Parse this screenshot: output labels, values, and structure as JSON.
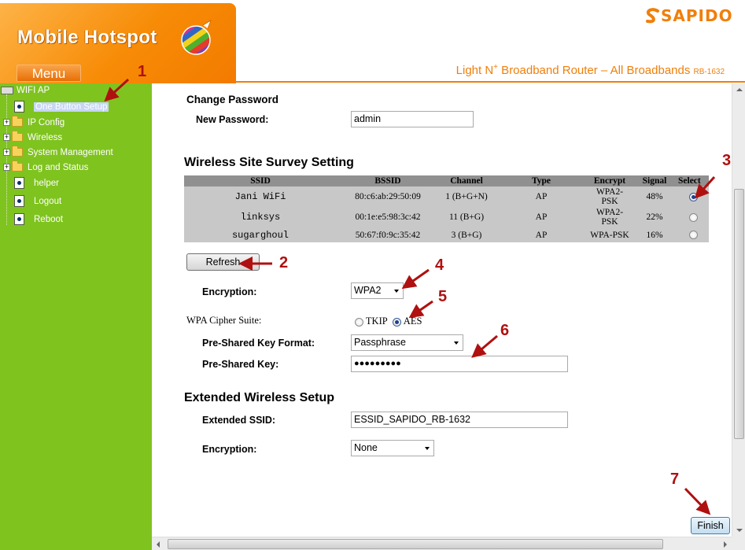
{
  "header": {
    "title": "Mobile Hotspot",
    "menu_label": "Menu",
    "logo_text": "SAPIDO",
    "tagline_prefix": "Light N",
    "tagline_sup": "+",
    "tagline_main": " Broadband Router – All Broadbands ",
    "tagline_model": "RB-1632"
  },
  "sidebar": {
    "root_label": "WIFI AP",
    "items": [
      {
        "label": "One Button Setup",
        "type": "page",
        "selected": true
      },
      {
        "label": "IP Config",
        "type": "folder"
      },
      {
        "label": "Wireless",
        "type": "folder"
      },
      {
        "label": "System Management",
        "type": "folder"
      },
      {
        "label": "Log and Status",
        "type": "folder"
      },
      {
        "label": "helper",
        "type": "page"
      },
      {
        "label": "Logout",
        "type": "page"
      },
      {
        "label": "Reboot",
        "type": "page"
      }
    ]
  },
  "change_password": {
    "title": "Change Password",
    "new_password_label": "New Password:",
    "new_password_value": "admin"
  },
  "survey": {
    "title": "Wireless Site Survey Setting",
    "columns": [
      "SSID",
      "BSSID",
      "Channel",
      "Type",
      "Encrypt",
      "Signal",
      "Select"
    ],
    "rows": [
      {
        "ssid": "Jani WiFi",
        "bssid": "80:c6:ab:29:50:09",
        "channel": "1 (B+G+N)",
        "type": "AP",
        "encrypt": "WPA2-PSK",
        "signal": "48%",
        "selected": true
      },
      {
        "ssid": "linksys",
        "bssid": "00:1e:e5:98:3c:42",
        "channel": "11 (B+G)",
        "type": "AP",
        "encrypt": "WPA2-PSK",
        "signal": "22%",
        "selected": false
      },
      {
        "ssid": "sugarghoul",
        "bssid": "50:67:f0:9c:35:42",
        "channel": "3 (B+G)",
        "type": "AP",
        "encrypt": "WPA-PSK",
        "signal": "16%",
        "selected": false
      }
    ],
    "refresh_label": "Refresh"
  },
  "security": {
    "encryption_label": "Encryption:",
    "encryption_value": "WPA2",
    "cipher_label": "WPA Cipher Suite:",
    "cipher_options": [
      "TKIP",
      "AES"
    ],
    "cipher_selected": "AES",
    "psk_format_label": "Pre-Shared Key Format:",
    "psk_format_value": "Passphrase",
    "psk_label": "Pre-Shared Key:",
    "psk_value": "●●●●●●●●●"
  },
  "extended": {
    "title": "Extended Wireless Setup",
    "ssid_label": "Extended SSID:",
    "ssid_value": "ESSID_SAPIDO_RB-1632",
    "encryption_label": "Encryption:",
    "encryption_value": "None"
  },
  "finish_label": "Finish",
  "annotations": [
    "1",
    "2",
    "3",
    "4",
    "5",
    "6",
    "7"
  ],
  "colors": {
    "orange": "#f07f0a",
    "sidebar_green": "#7fc31f",
    "annotation_red": "#b01010",
    "table_header": "#909090",
    "table_row": "#c8c8c8"
  }
}
